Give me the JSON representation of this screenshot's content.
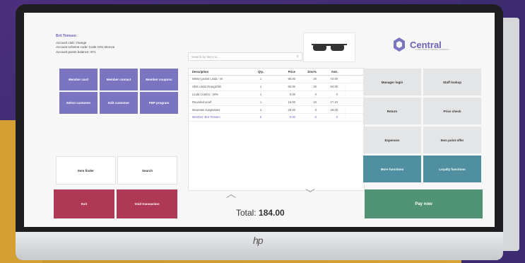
{
  "customer": {
    "name": "Brit Tomsen",
    "club": "Account club: Orange",
    "scheme": "Account scheme code: Code CR1 Bronze",
    "points": "Account points balance: 971"
  },
  "search": {
    "placeholder": "Search by item no."
  },
  "brand": {
    "name": "Central",
    "tagline": "A NORTHEAST RETAIL COMPANY"
  },
  "left_buttons": {
    "member_card": "Member card",
    "member_contact": "Member contact",
    "member_coupons": "Member coupons",
    "select_customer": "Select customer",
    "edit_customer": "Edit customer",
    "fbp_program": "FBP program",
    "item_finder": "Item finder",
    "search": "Search",
    "exit": "Exit",
    "void_transaction": "Void transaction"
  },
  "table": {
    "headers": [
      "Description",
      "Qty.",
      "Price",
      "Disc%",
      "Amt."
    ],
    "rows": [
      {
        "desc": "Winter jacket Linda - M",
        "qty": "1",
        "price": "90.00",
        "disc": "20",
        "amt": "72.00"
      },
      {
        "desc": "Skirt Linda Orange/38",
        "qty": "1",
        "price": "80.00",
        "disc": "20",
        "amt": "64.00"
      },
      {
        "desc": "Linda Combo - 20%",
        "qty": "1",
        "price": "0.00",
        "disc": "0",
        "amt": "0"
      },
      {
        "desc": "Rounded scarf",
        "qty": "1",
        "price": "19.00",
        "disc": "10",
        "amt": "17.10"
      },
      {
        "desc": "Mountain sunglasses",
        "qty": "1",
        "price": "29.00",
        "disc": "0",
        "amt": "29.00"
      },
      {
        "desc": "Member: Brit Tomsen",
        "qty": "0",
        "price": "0.00",
        "disc": "0",
        "amt": "0"
      }
    ]
  },
  "total": {
    "label": "Total:",
    "value": "184.00"
  },
  "right_buttons": {
    "manager_login": "Manager login",
    "staff_lookup": "Staff lookup",
    "return": "Return",
    "price_check": "Price check",
    "expenses": "Expenses",
    "item_point_offer": "Item point offer",
    "more_functions": "More functions",
    "loyalty_functions": "Loyalty functions",
    "pay_now": "Pay now"
  },
  "colors": {
    "purple": "#7b74c1",
    "red": "#b03857",
    "teal": "#4f8f9f",
    "green": "#4f9274",
    "brand": "#6b62b5"
  }
}
